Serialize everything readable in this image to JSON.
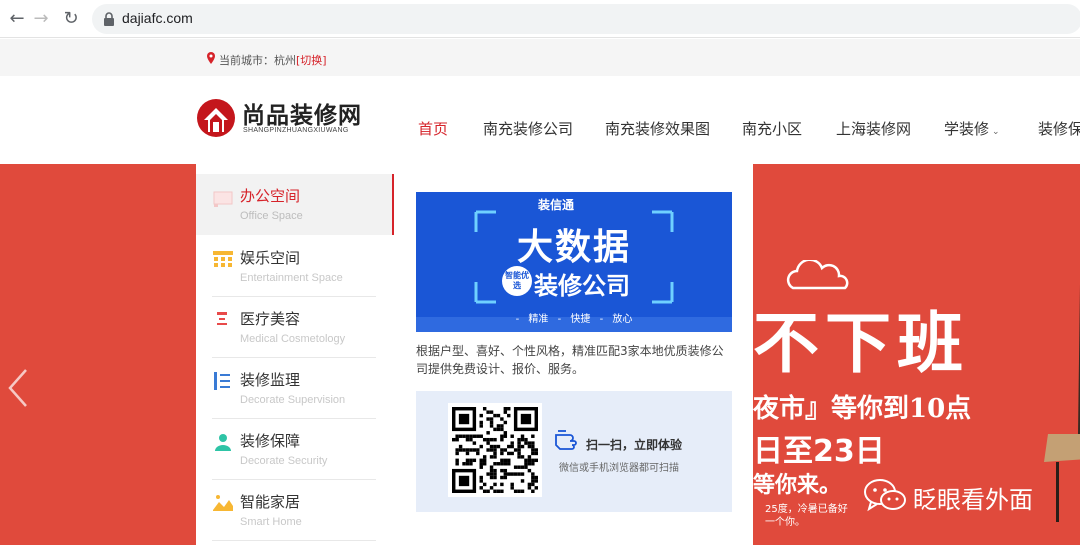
{
  "browser": {
    "url": "dajiafc.com"
  },
  "city_bar": {
    "label": "当前城市：",
    "city": "杭州",
    "switch_label": "[切换]"
  },
  "logo": {
    "title": "尚品装修网",
    "subtitle": "SHANGPINZHUANGXIUWANG"
  },
  "nav": {
    "items": [
      {
        "label": "首页",
        "active": true
      },
      {
        "label": "南充装修公司"
      },
      {
        "label": "南充装修效果图"
      },
      {
        "label": "南充小区"
      },
      {
        "label": "上海装修网"
      },
      {
        "label": "学装修",
        "has_dropdown": true
      },
      {
        "label": "装修保"
      }
    ]
  },
  "categories": [
    {
      "name": "办公空间",
      "en": "Office Space",
      "active": true,
      "icon": "office-icon"
    },
    {
      "name": "娱乐空间",
      "en": "Entertainment Space",
      "icon": "entertainment-icon"
    },
    {
      "name": "医疗美容",
      "en": "Medical Cosmetology",
      "icon": "medical-icon"
    },
    {
      "name": "装修监理",
      "en": "Decorate Supervision",
      "icon": "supervision-icon"
    },
    {
      "name": "装修保障",
      "en": "Decorate Security",
      "icon": "security-icon"
    },
    {
      "name": "智能家居",
      "en": "Smart Home",
      "icon": "smart-home-icon"
    }
  ],
  "ad": {
    "brand": "装信通",
    "title": "大数据",
    "badge": "智能优选",
    "subtitle": "装修公司",
    "tags": "- 精准  - 快捷  - 放心",
    "description": "根据户型、喜好、个性风格，精准匹配3家本地优质装修公司提供免费设计、报价、服务。"
  },
  "qr": {
    "title": "扫一扫，立即体验",
    "subtitle": "微信或手机浏览器都可扫描"
  },
  "banner": {
    "headline": "不下班",
    "line1": "夜市』等你到10点",
    "line2": "日至23日",
    "line3": "等你来。",
    "line4": "25度，冷暑已备好",
    "line5": "一个你。"
  },
  "watermark": {
    "text": "眨眼看外面"
  },
  "colors": {
    "accent": "#d6232a",
    "banner": "#e04a3c",
    "ad_blue": "#1a56d6"
  }
}
